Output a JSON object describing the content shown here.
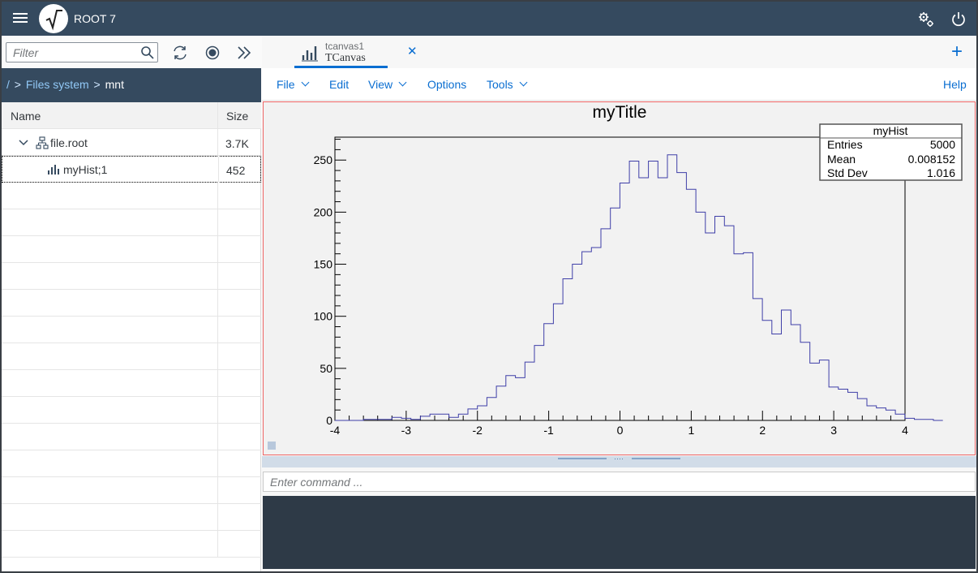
{
  "app": {
    "title": "ROOT 7"
  },
  "browser": {
    "filter_placeholder": "Filter",
    "breadcrumb": {
      "root": "/",
      "folder": "Files system",
      "current": "mnt"
    },
    "columns": {
      "name": "Name",
      "size": "Size"
    },
    "rows": [
      {
        "name": "file.root",
        "size": "3.7K"
      },
      {
        "name": "myHist;1",
        "size": "452"
      }
    ]
  },
  "tabs": [
    {
      "subtitle": "tcanvas1",
      "label": "TCanvas"
    }
  ],
  "menu": {
    "file": "File",
    "edit": "Edit",
    "view": "View",
    "options": "Options",
    "tools": "Tools",
    "help": "Help"
  },
  "command": {
    "placeholder": "Enter command ..."
  },
  "colors": {
    "shell": "#354a5f",
    "accent": "#0a6ed1",
    "histogram_line": "#3f3fa8"
  },
  "chart_data": {
    "type": "histogram",
    "title": "myTitle",
    "xlim": [
      -4,
      4
    ],
    "ylim": [
      0,
      272
    ],
    "x_ticks": [
      -4,
      -3,
      -2,
      -1,
      0,
      1,
      2,
      3,
      4
    ],
    "y_ticks": [
      0,
      50,
      100,
      150,
      200,
      250
    ],
    "bin_edges_start": -4,
    "bin_width": 0.1333,
    "values": [
      0,
      0,
      0,
      1,
      1,
      1,
      3,
      2,
      1,
      4,
      6,
      6,
      3,
      6,
      11,
      14,
      22,
      33,
      43,
      41,
      56,
      72,
      93,
      112,
      136,
      150,
      162,
      166,
      184,
      204,
      228,
      249,
      233,
      249,
      233,
      255,
      238,
      222,
      200,
      180,
      196,
      187,
      160,
      161,
      117,
      96,
      83,
      106,
      92,
      75,
      55,
      58,
      32,
      30,
      27,
      21,
      14,
      12,
      10,
      6,
      2,
      1,
      1,
      0
    ],
    "stats": {
      "name": "myHist",
      "entries_label": "Entries",
      "entries": "5000",
      "mean_label": "Mean",
      "mean": "0.008152",
      "std_label": "Std Dev",
      "std": "1.016"
    }
  }
}
